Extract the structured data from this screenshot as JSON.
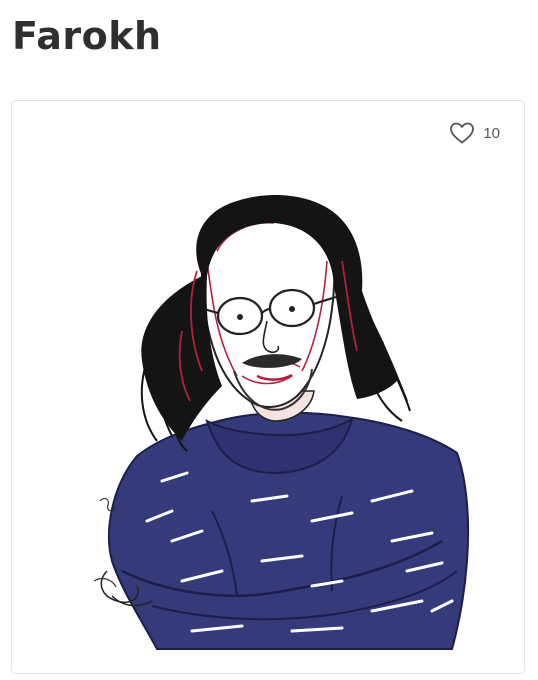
{
  "page": {
    "title": "Farokh"
  },
  "card": {
    "likes": "10",
    "icons": {
      "like": "heart-outline-icon"
    },
    "colors": {
      "sweater": "#353a7a",
      "hair": "#141414",
      "accent_red": "#b3203e",
      "border": "#e3e3e3",
      "title": "#2f2f31"
    }
  }
}
